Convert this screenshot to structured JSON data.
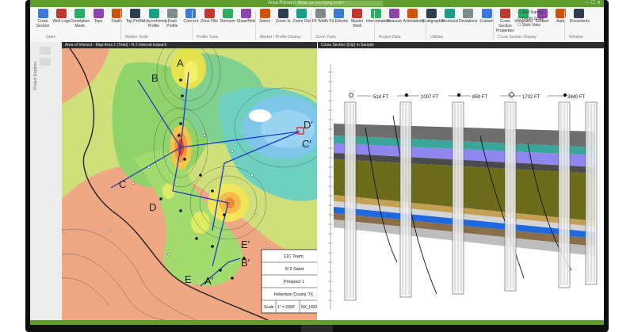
{
  "window": {
    "title": "Area Presentation",
    "search_placeholder": "What are you trying to do?",
    "window_controls": "—  ☐  ✕"
  },
  "ribbon": {
    "buttons": [
      "Cross Section",
      "Well Logs",
      "Correlation Mode",
      "Tops",
      "Faults",
      "Top Profile",
      "Unconformity Profile",
      "Fault Profile",
      "Connect",
      "Zone Fills",
      "Remove",
      "Show/Hide",
      "Select",
      "Zoom In",
      "Zoom Out",
      "Fit Width",
      "Fit Extents",
      "Master Shell",
      "Interpretation",
      "Measure",
      "Annotations",
      "Stratigraphic",
      "Structural",
      "Deviations",
      "Custom",
      "Cross Section Properties",
      "Integrated",
      "Embed",
      "Auto",
      "Documents"
    ],
    "groups": [
      "Open",
      "Marker Tools",
      "Profile Tools",
      "Marker / Profile Display",
      "Zoom Tools",
      "Project Data",
      "Utilities",
      "Cross Section Display",
      "Window"
    ],
    "checkbox_labels": [
      "Well Names",
      "Depth Scale",
      "Stick View"
    ],
    "zoom_readout": "Zoom"
  },
  "left_panel": {
    "label": "Project Explorer"
  },
  "map_pane": {
    "tab_title": "Area of Interest - Map Area 1 (Total) - N 2 Interval Isopach",
    "point_labels": [
      "A",
      "B",
      "C",
      "D",
      "E",
      "A'",
      "B'",
      "C'",
      "D'",
      "E'"
    ],
    "title_block": {
      "team": "11C Team",
      "zone": "N 2 Sand",
      "prospect": "Prospect 1",
      "county": "Robertson County, TX",
      "scale_label": "Scale",
      "scale_value": "1\" = 2000'",
      "file_id": "NX_U509"
    }
  },
  "xsection_pane": {
    "tab_title": "Cross Section (Dip) in Sample",
    "distances": [
      "514 FT",
      "1007 FT",
      "850 FT",
      "1702 FT",
      "3840 FT"
    ]
  },
  "colors": {
    "accent": "#5f9d2f",
    "map_background": "#f0a784",
    "cross_section_line": "#2040c0"
  }
}
